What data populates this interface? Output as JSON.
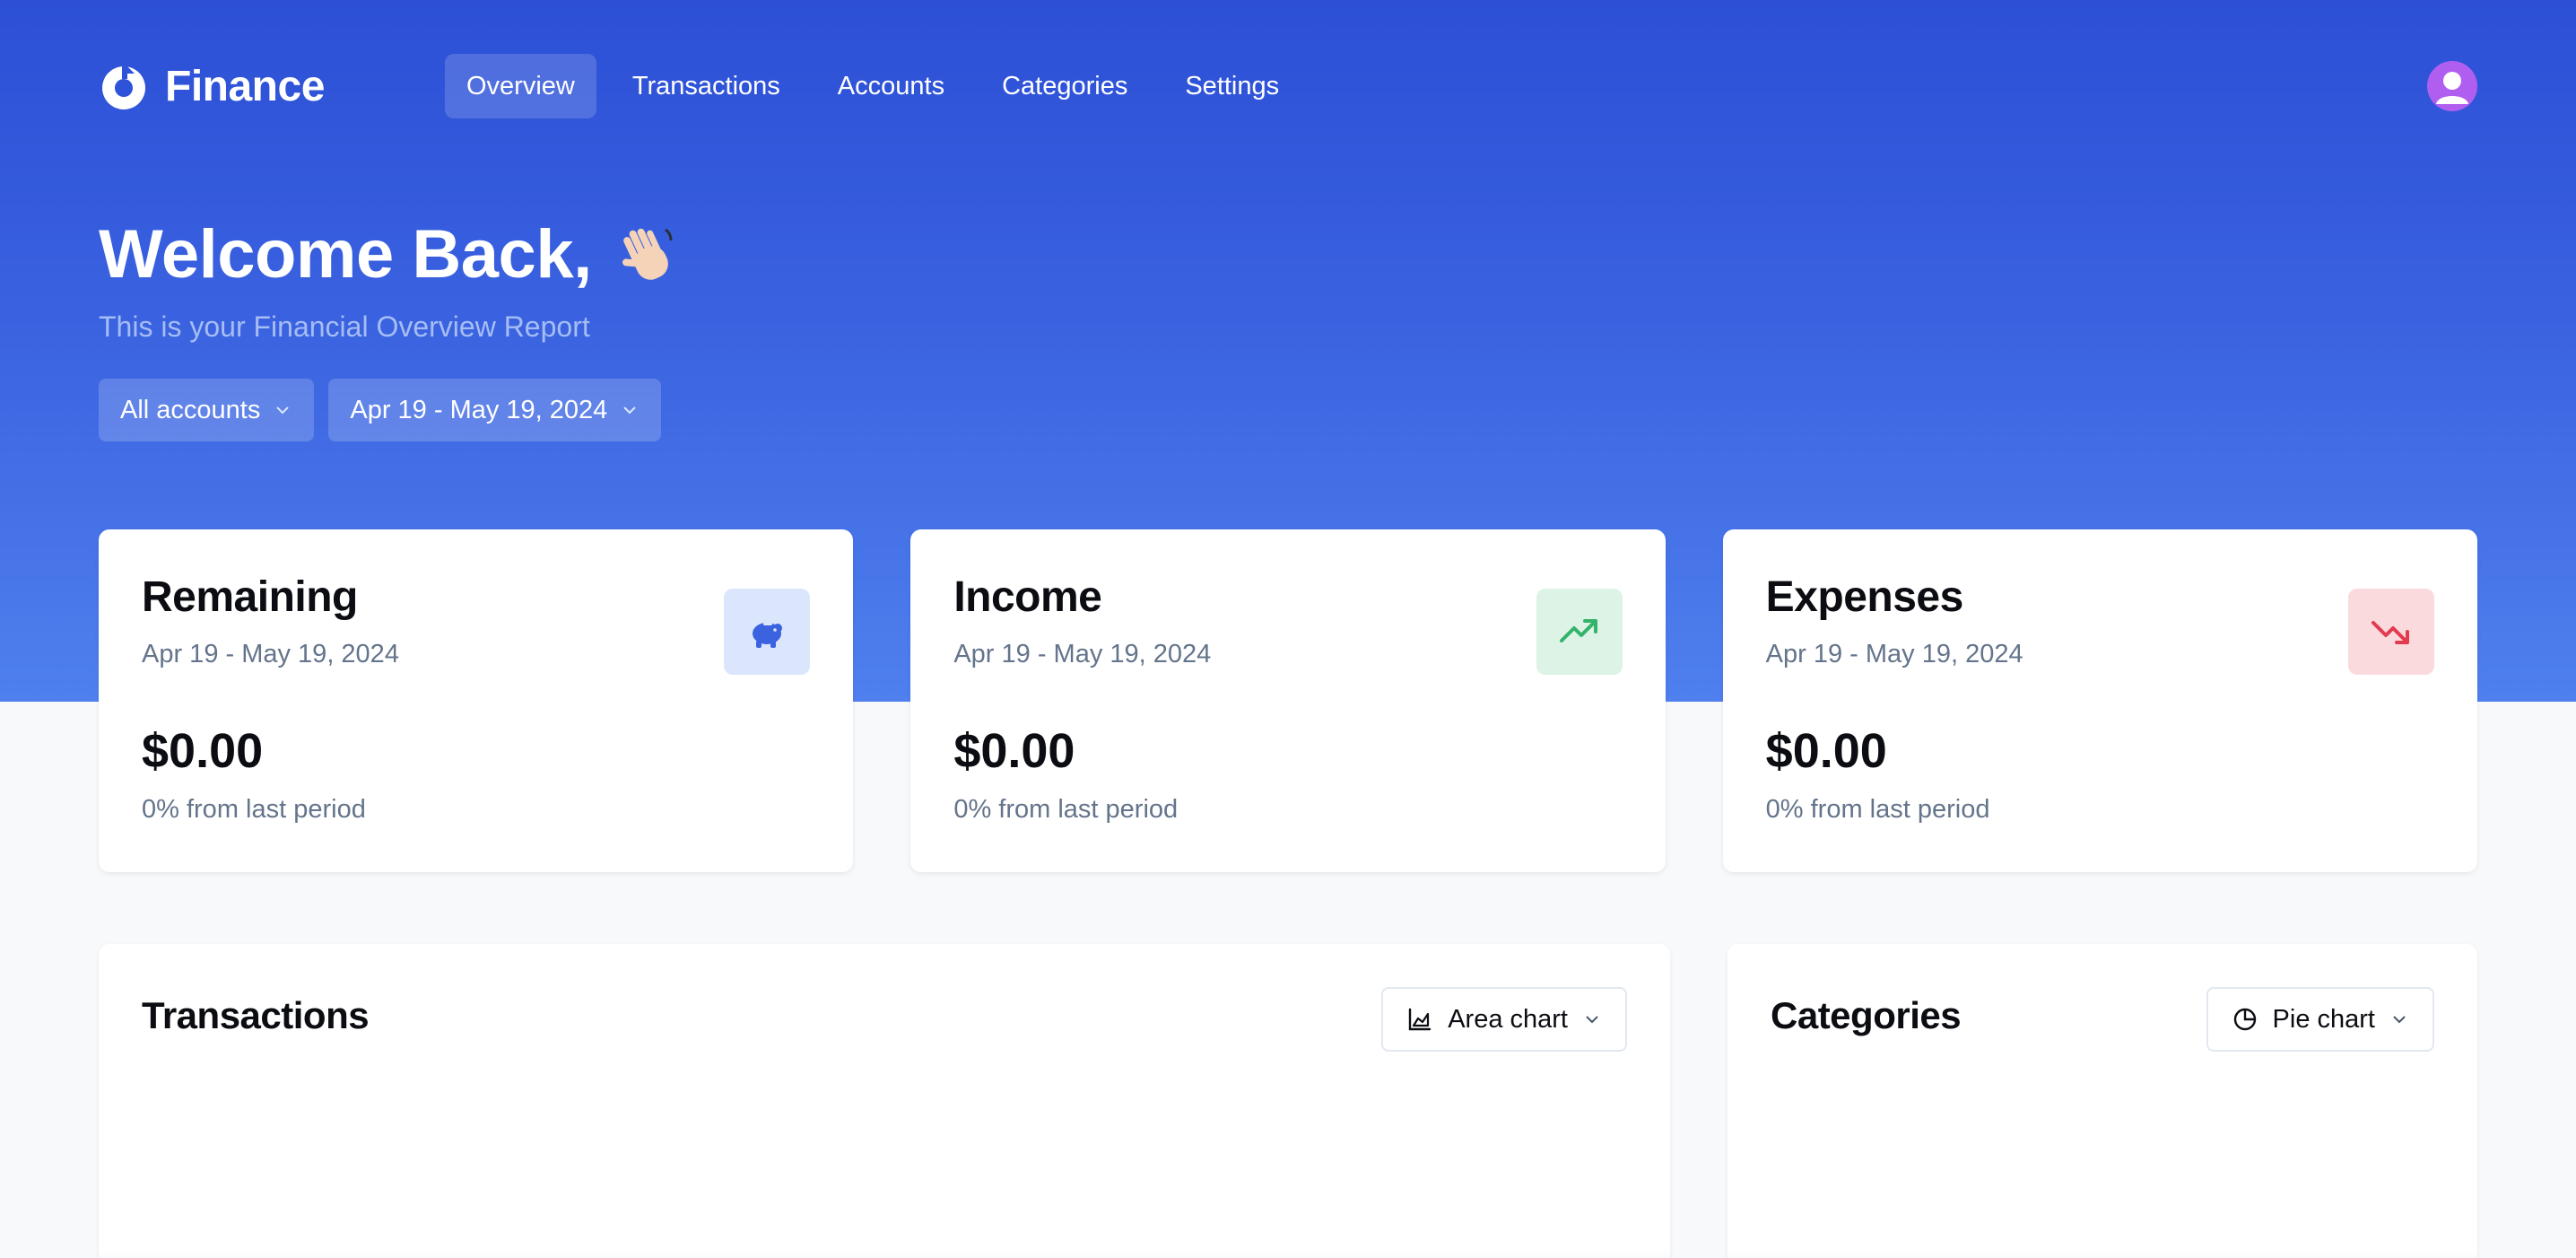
{
  "app": {
    "name": "Finance"
  },
  "nav": {
    "items": [
      {
        "label": "Overview",
        "active": true
      },
      {
        "label": "Transactions",
        "active": false
      },
      {
        "label": "Accounts",
        "active": false
      },
      {
        "label": "Categories",
        "active": false
      },
      {
        "label": "Settings",
        "active": false
      }
    ]
  },
  "welcome": {
    "title": "Welcome Back,",
    "subtitle": "This is your Financial Overview Report"
  },
  "filters": {
    "account": "All accounts",
    "date_range": "Apr 19 - May 19, 2024"
  },
  "cards": [
    {
      "title": "Remaining",
      "range": "Apr 19 - May 19, 2024",
      "value": "$0.00",
      "delta": "0% from last period",
      "icon": "piggy-bank-icon",
      "color": "#3b63e0"
    },
    {
      "title": "Income",
      "range": "Apr 19 - May 19, 2024",
      "value": "$0.00",
      "delta": "0% from last period",
      "icon": "trending-up-icon",
      "color": "#34b36b"
    },
    {
      "title": "Expenses",
      "range": "Apr 19 - May 19, 2024",
      "value": "$0.00",
      "delta": "0% from last period",
      "icon": "trending-down-icon",
      "color": "#e23b4f"
    }
  ],
  "panels": {
    "transactions": {
      "title": "Transactions",
      "select": "Area chart"
    },
    "categories": {
      "title": "Categories",
      "select": "Pie chart"
    }
  },
  "colors": {
    "brand": "#2c4fd6",
    "avatar": "#b05ef0"
  }
}
